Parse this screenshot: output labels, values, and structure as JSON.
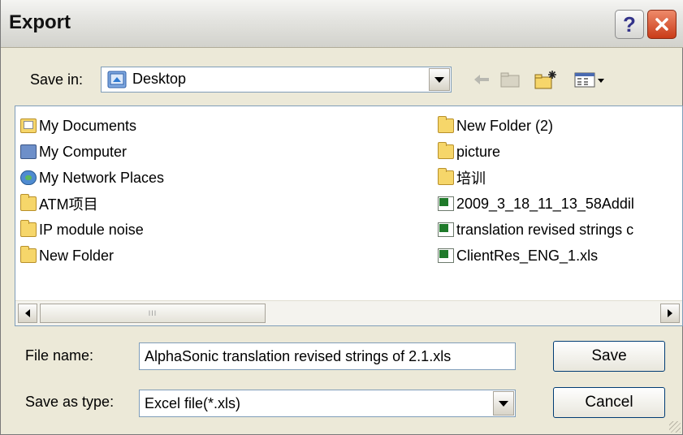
{
  "window": {
    "title": "Export",
    "help_glyph": "?",
    "close_glyph": "✕"
  },
  "save_in": {
    "label": "Save in:",
    "value": "Desktop"
  },
  "file_list": {
    "left_column": [
      {
        "name": "My Documents",
        "icon": "my-documents-icon"
      },
      {
        "name": "My Computer",
        "icon": "my-computer-icon"
      },
      {
        "name": "My Network Places",
        "icon": "network-places-icon"
      },
      {
        "name": "ATM项目",
        "icon": "folder-icon"
      },
      {
        "name": "IP module noise",
        "icon": "folder-icon"
      },
      {
        "name": "New Folder",
        "icon": "folder-icon"
      }
    ],
    "right_column": [
      {
        "name": "New Folder (2)",
        "icon": "folder-icon"
      },
      {
        "name": "picture",
        "icon": "folder-icon"
      },
      {
        "name": "培训",
        "icon": "folder-icon"
      },
      {
        "name": "2009_3_18_11_13_58Addil",
        "icon": "excel-file-icon"
      },
      {
        "name": "translation revised strings c",
        "icon": "excel-file-icon"
      },
      {
        "name": "ClientRes_ENG_1.xls",
        "icon": "excel-file-icon"
      }
    ]
  },
  "file_name": {
    "label": "File name:",
    "value": "AlphaSonic translation revised strings of 2.1.xls"
  },
  "save_as_type": {
    "label": "Save as type:",
    "value": "Excel file(*.xls)"
  },
  "buttons": {
    "save": "Save",
    "cancel": "Cancel"
  },
  "scrollbar": {
    "thumb_grip": "III"
  }
}
